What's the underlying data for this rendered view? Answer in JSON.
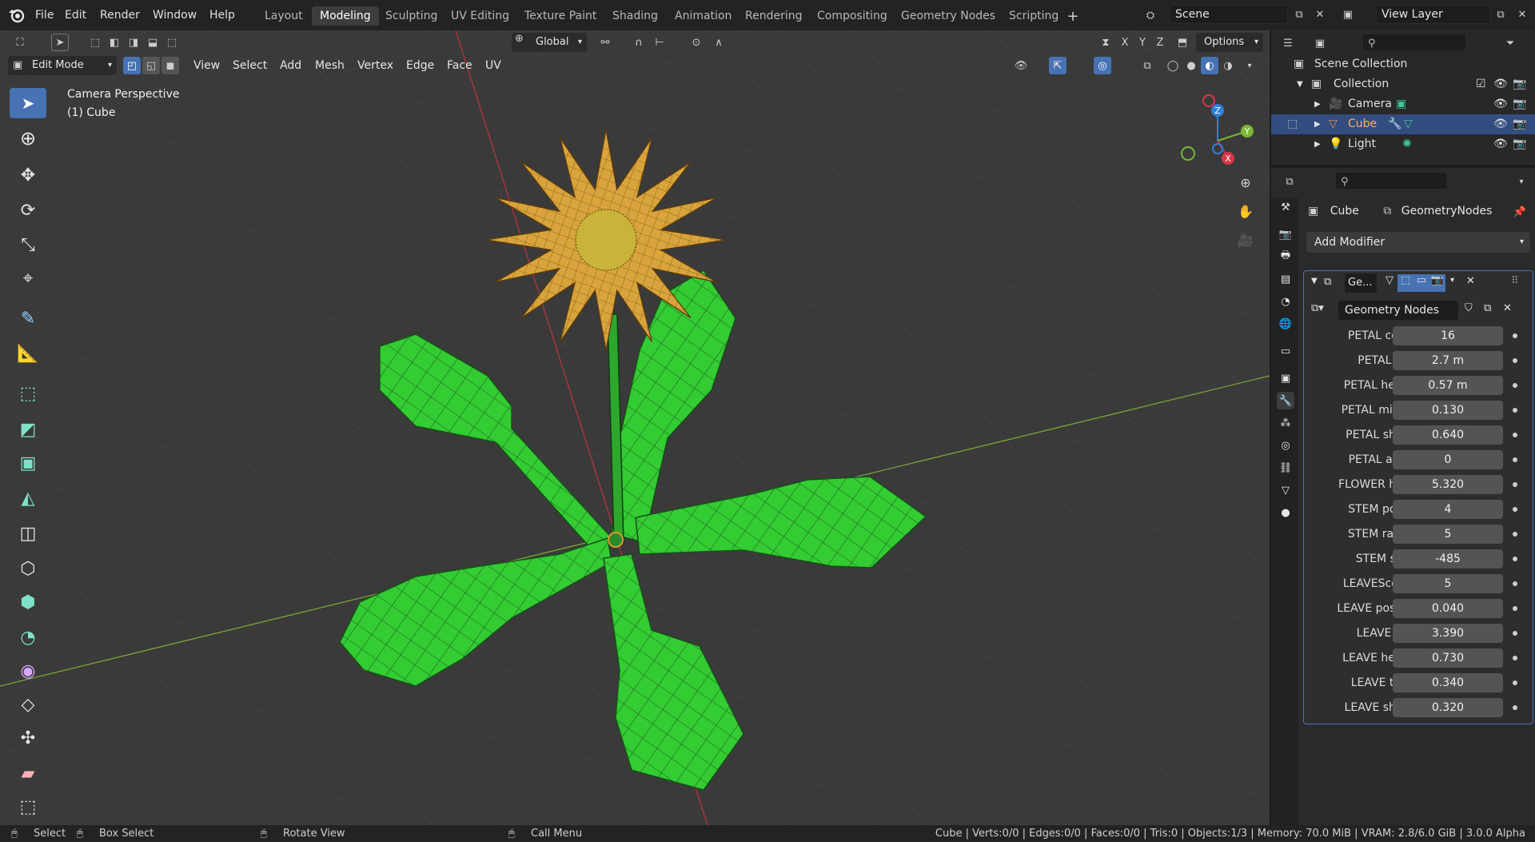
{
  "menu": [
    "File",
    "Edit",
    "Render",
    "Window",
    "Help"
  ],
  "workspaces": [
    "Layout",
    "Modeling",
    "Sculpting",
    "UV Editing",
    "Texture Paint",
    "Shading",
    "Animation",
    "Rendering",
    "Compositing",
    "Geometry Nodes",
    "Scripting"
  ],
  "active_workspace": "Modeling",
  "scene": "Scene",
  "view_layer": "View Layer",
  "header": {
    "transform_orientation": "Global",
    "options": "Options",
    "axes": [
      "X",
      "Y",
      "Z"
    ],
    "mode": "Edit Mode",
    "menus": [
      "View",
      "Select",
      "Add",
      "Mesh",
      "Vertex",
      "Edge",
      "Face",
      "UV"
    ]
  },
  "viewport": {
    "perspective": "Camera Perspective",
    "object": "(1) Cube",
    "gizmo": {
      "z": "Z",
      "y": "Y",
      "x": "X"
    }
  },
  "outliner": {
    "root": "Scene Collection",
    "collection": "Collection",
    "items": [
      {
        "name": "Camera",
        "selected": false
      },
      {
        "name": "Cube",
        "selected": true
      },
      {
        "name": "Light",
        "selected": false
      }
    ]
  },
  "properties": {
    "object": "Cube",
    "modifier_tab": "GeometryNodes",
    "add_modifier": "Add Modifier",
    "modifier_name": "Ge...",
    "node_group": "Geometry Nodes",
    "params": [
      {
        "label": "PETAL count",
        "value": "16"
      },
      {
        "label": "PETAL size",
        "value": "2.7 m"
      },
      {
        "label": "PETAL height",
        "value": "0.57 m"
      },
      {
        "label": "PETAL middle",
        "value": "0.130"
      },
      {
        "label": "PETAL shape",
        "value": "0.640"
      },
      {
        "label": "PETAL angle",
        "value": "0"
      },
      {
        "label": "FLOWER hei...",
        "value": "5.320"
      },
      {
        "label": "STEM points",
        "value": "4"
      },
      {
        "label": "STEM radius",
        "value": "5"
      },
      {
        "label": "STEM seed",
        "value": "-485"
      },
      {
        "label": "LEAVEScount",
        "value": "5"
      },
      {
        "label": "LEAVE positi...",
        "value": "0.040"
      },
      {
        "label": "LEAVE size",
        "value": "3.390"
      },
      {
        "label": "LEAVE height",
        "value": "0.730"
      },
      {
        "label": "LEAVE thick",
        "value": "0.340"
      },
      {
        "label": "LEAVE shape",
        "value": "0.320"
      }
    ]
  },
  "statusbar": {
    "select": "Select",
    "box_select": "Box Select",
    "rotate": "Rotate View",
    "call_menu": "Call Menu",
    "stats": "Cube | Verts:0/0 | Edges:0/0 | Faces:0/0 | Tris:0 | Objects:1/3 | Memory: 70.0 MiB | VRAM: 2.8/6.0 GiB | 3.0.0 Alpha"
  },
  "colors": {
    "accent": "#4772b3",
    "leaf": "#2fcf2f",
    "petal": "#d9a43c",
    "selected_row": "#334d80"
  }
}
